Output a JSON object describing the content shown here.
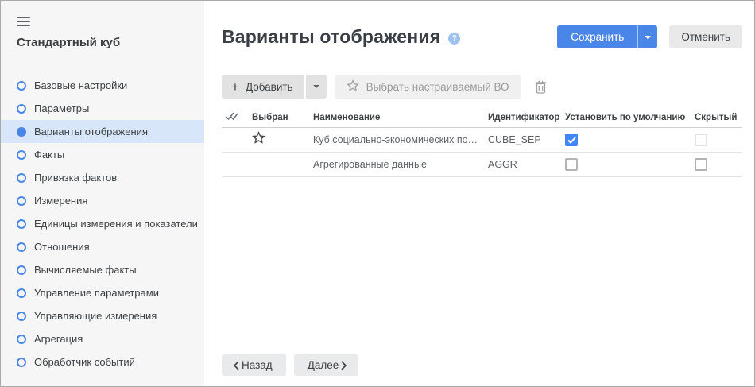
{
  "sidebar": {
    "title": "Стандартный куб",
    "active_index": 2,
    "items": [
      {
        "label": "Базовые настройки"
      },
      {
        "label": "Параметры"
      },
      {
        "label": "Варианты отображения"
      },
      {
        "label": "Факты"
      },
      {
        "label": "Привязка фактов"
      },
      {
        "label": "Измерения"
      },
      {
        "label": "Единицы измерения и показатели"
      },
      {
        "label": "Отношения"
      },
      {
        "label": "Вычисляемые факты"
      },
      {
        "label": "Управление параметрами"
      },
      {
        "label": "Управляющие измерения"
      },
      {
        "label": "Агрегация"
      },
      {
        "label": "Обработчик событий"
      }
    ]
  },
  "header": {
    "title": "Варианты отображения",
    "help_glyph": "?",
    "save_label": "Сохранить",
    "cancel_label": "Отменить"
  },
  "toolbar": {
    "add_label": "Добавить",
    "add_plus_glyph": "+",
    "select_custom_label": "Выбрать настраиваемый ВО"
  },
  "table": {
    "columns": {
      "selected": "Выбран",
      "name": "Наименование",
      "identifier": "Идентификатор",
      "default": "Установить по умолчанию",
      "hidden": "Скрытый"
    },
    "rows": [
      {
        "selected": true,
        "name": "Куб социально-экономических показат...",
        "identifier": "CUBE_SEP",
        "default_checked": true,
        "hidden_checked": false,
        "hidden_disabled": true
      },
      {
        "selected": false,
        "name": "Агрегированные данные",
        "identifier": "AGGR",
        "default_checked": false,
        "hidden_checked": false,
        "hidden_disabled": false
      }
    ]
  },
  "footer": {
    "back_label": "Назад",
    "next_label": "Далее"
  },
  "colors": {
    "accent": "#4a86e8",
    "checkbox_checked": "#4285f4",
    "sidebar_bg": "#f6f6f6",
    "active_item_bg": "#d8e6fa"
  }
}
